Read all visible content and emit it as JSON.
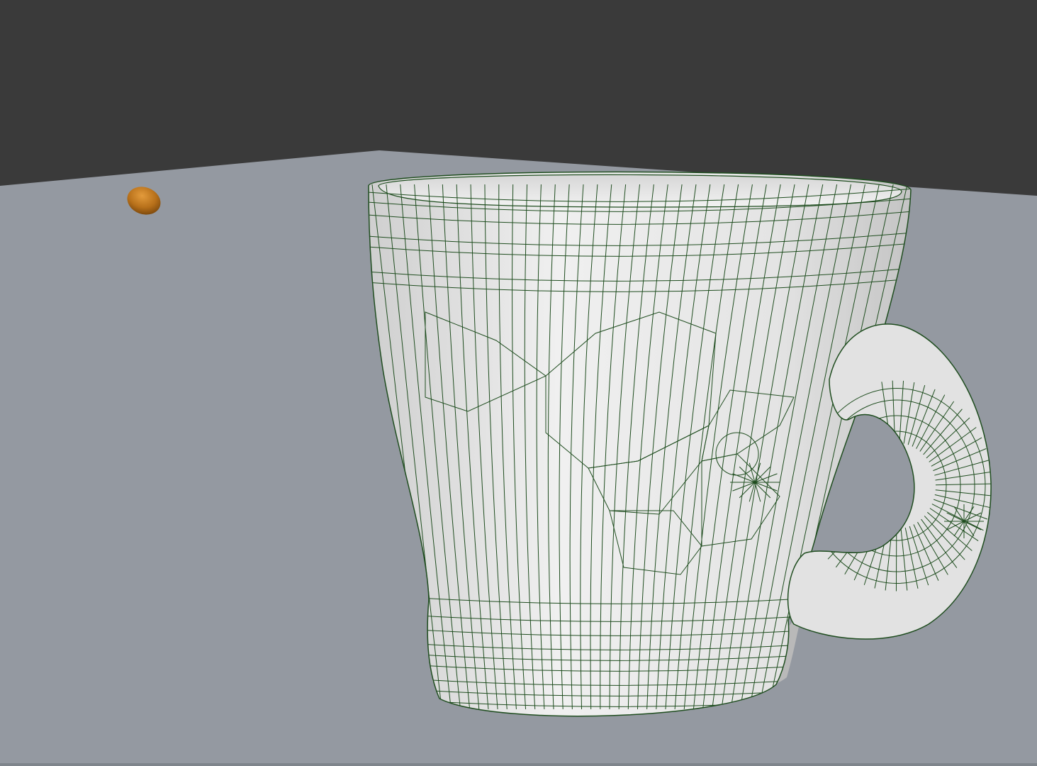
{
  "viewport": {
    "background_color": "#3a3a3a",
    "floor_color": "#9499a1",
    "mug_body_color": "#e6e6e6",
    "mug_shadow_color": "#bcbcbc",
    "wireframe_color": "#1f4d1f",
    "pebble_color": "#b7701a"
  },
  "scene": {
    "objects": [
      "mug-mesh",
      "pebble",
      "floor-plane"
    ],
    "shading": "solid-with-wireframe"
  }
}
